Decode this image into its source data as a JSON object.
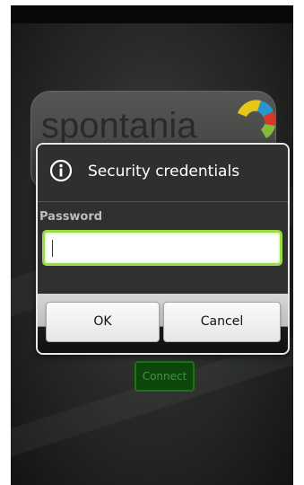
{
  "background_app": {
    "logo_text": "spontania",
    "connect_label": "Connect"
  },
  "dialog": {
    "title": "Security credentials",
    "icon": "info-icon",
    "field_label": "Password",
    "password_value": "",
    "ok_label": "OK",
    "cancel_label": "Cancel"
  },
  "colors": {
    "input_focus": "#9bdc46",
    "connect_green": "#0c4b0c"
  }
}
